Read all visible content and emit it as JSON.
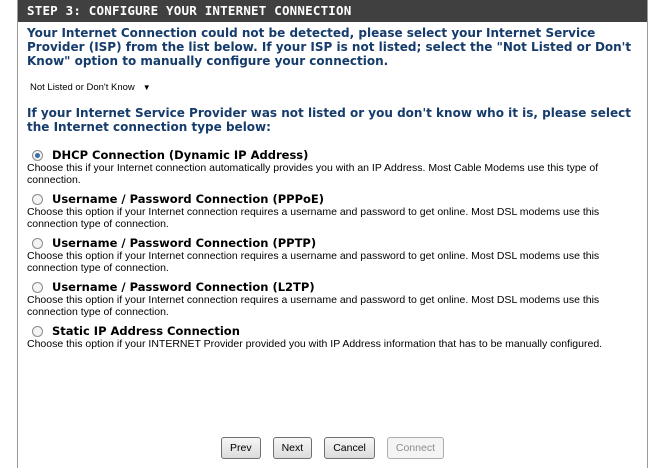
{
  "header": {
    "title": "STEP 3: CONFIGURE YOUR INTERNET CONNECTION"
  },
  "intro": "Your Internet Connection could not be detected, please select your Internet Service Provider (ISP) from the list below. If your ISP is not listed; select the \"Not Listed or Don't Know\" option to manually configure your connection.",
  "isp_select": {
    "value": "Not Listed or Don't Know",
    "icon": "chevron-down-icon"
  },
  "subhead": "If your Internet Service Provider was not listed or you don't know who it is, please select the Internet connection type below:",
  "options": [
    {
      "label": "DHCP Connection (Dynamic IP Address)",
      "description": "Choose this if your Internet connection automatically provides you with an IP Address. Most Cable Modems use this type of connection.",
      "selected": true
    },
    {
      "label": "Username / Password Connection (PPPoE)",
      "description": "Choose this option if your Internet connection requires a username and password to get online. Most DSL modems use this connection type of connection.",
      "selected": false
    },
    {
      "label": "Username / Password Connection (PPTP)",
      "description": "Choose this option if your Internet connection requires a username and password to get online. Most DSL modems use this connection type of connection.",
      "selected": false
    },
    {
      "label": "Username / Password Connection (L2TP)",
      "description": "Choose this option if your Internet connection requires a username and password to get online. Most DSL modems use this connection type of connection.",
      "selected": false
    },
    {
      "label": "Static IP Address Connection",
      "description": "Choose this option if your INTERNET Provider provided you with IP Address information that has to be manually configured.",
      "selected": false
    }
  ],
  "buttons": {
    "prev": "Prev",
    "next": "Next",
    "cancel": "Cancel",
    "connect": "Connect"
  },
  "colors": {
    "header_bg": "#404040",
    "heading_text": "#163c6b"
  }
}
